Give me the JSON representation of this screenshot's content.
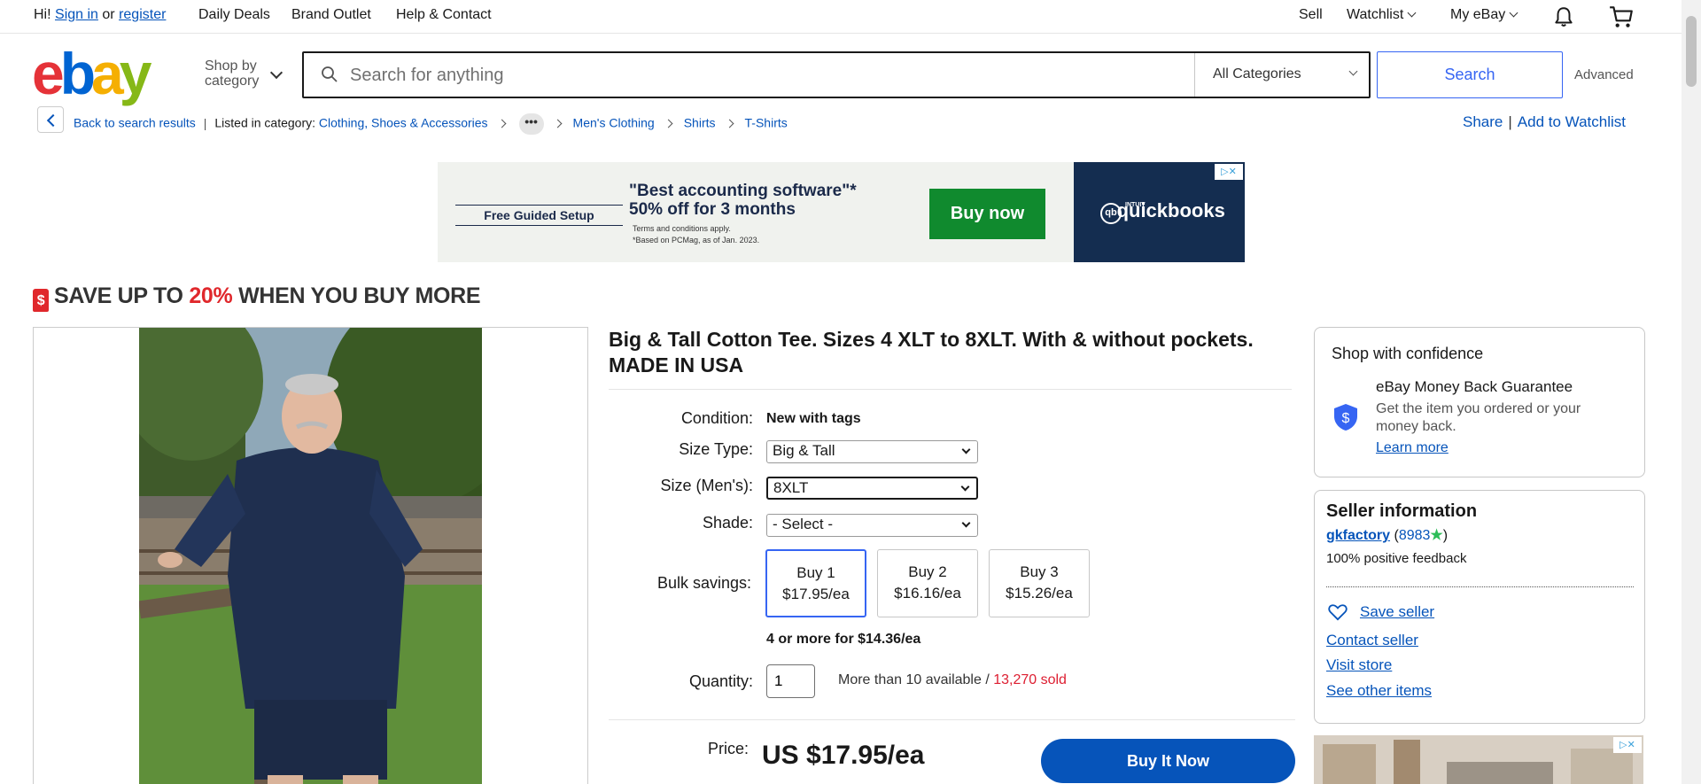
{
  "topbar": {
    "greeting": "Hi!",
    "sign_in": "Sign in",
    "or": "or",
    "register": "register",
    "daily_deals": "Daily Deals",
    "brand_outlet": "Brand Outlet",
    "help": "Help & Contact",
    "sell": "Sell",
    "watchlist": "Watchlist",
    "my_ebay": "My eBay"
  },
  "header": {
    "logo": [
      "e",
      "b",
      "a",
      "y"
    ],
    "shop_by_category": [
      "Shop by",
      "category"
    ],
    "search_placeholder": "Search for anything",
    "category_selected": "All Categories",
    "search_button": "Search",
    "advanced": "Advanced"
  },
  "breadcrumb": {
    "back": "Back to search results",
    "listed_in": "Listed in category:",
    "items": [
      "Clothing, Shoes & Accessories",
      "Men's Clothing",
      "Shirts",
      "T-Shirts"
    ],
    "more": "•••",
    "share": "Share",
    "add_watchlist": "Add to Watchlist"
  },
  "ad_banner": {
    "guided_setup": "Free Guided Setup",
    "headline_1": "\"Best accounting software\"*",
    "headline_2": "50% off for 3 months",
    "fine_1": "Terms and conditions apply.",
    "fine_2": "*Based on PCMag, as of Jan. 2023.",
    "cta": "Buy now",
    "brand_small": "INTUIT",
    "brand": "quickbooks",
    "brand_mark": "qb"
  },
  "promo": {
    "prefix": "SAVE UP TO ",
    "percent": "20%",
    "suffix": " WHEN YOU BUY MORE",
    "icon": "$"
  },
  "item": {
    "title": "Big & Tall Cotton Tee. Sizes 4 XLT to 8XLT. With & without pockets. MADE IN USA",
    "condition_label": "Condition:",
    "condition_value": "New with tags",
    "size_type_label": "Size Type:",
    "size_type_value": "Big & Tall",
    "size_label": "Size (Men's):",
    "size_value": "8XLT",
    "shade_label": "Shade:",
    "shade_value": "- Select -",
    "bulk_label": "Bulk savings:",
    "bulk_options": [
      {
        "label": "Buy 1",
        "price": "$17.95/ea",
        "selected": true
      },
      {
        "label": "Buy 2",
        "price": "$16.16/ea",
        "selected": false
      },
      {
        "label": "Buy 3",
        "price": "$15.26/ea",
        "selected": false
      }
    ],
    "bulk_more": "4 or more for $14.36/ea",
    "quantity_label": "Quantity:",
    "quantity_value": "1",
    "availability": "More than 10 available / ",
    "sold": "13,270 sold",
    "price_label": "Price:",
    "price": "US $17.95/ea",
    "buy_it_now": "Buy It Now"
  },
  "confidence": {
    "title": "Shop with confidence",
    "guarantee_title": "eBay Money Back Guarantee",
    "guarantee_text": "Get the item you ordered or your money back.",
    "learn_more": "Learn more"
  },
  "seller": {
    "title": "Seller information",
    "name": "gkfactory",
    "feedback_open": " (",
    "feedback_count": "8983",
    "feedback_close": ")",
    "star": "★",
    "positive": "100% positive feedback",
    "save_seller": "Save seller",
    "contact": "Contact seller",
    "visit_store": "Visit store",
    "other_items": "See other items"
  },
  "colors": {
    "ebay_red": "#e53238",
    "ebay_blue": "#0064d2",
    "ebay_yellow": "#f5af02",
    "ebay_green": "#86b817",
    "link_blue": "#0654ba",
    "primary_button": "#0654ba",
    "sold_red": "#dd1e31",
    "promo_red": "#e0282c"
  },
  "icons": {
    "notification": "bell-icon",
    "cart": "cart-icon",
    "search": "search-icon",
    "guarantee": "shield-dollar-icon",
    "save_seller": "heart-icon",
    "feedback_star": "star-icon"
  }
}
